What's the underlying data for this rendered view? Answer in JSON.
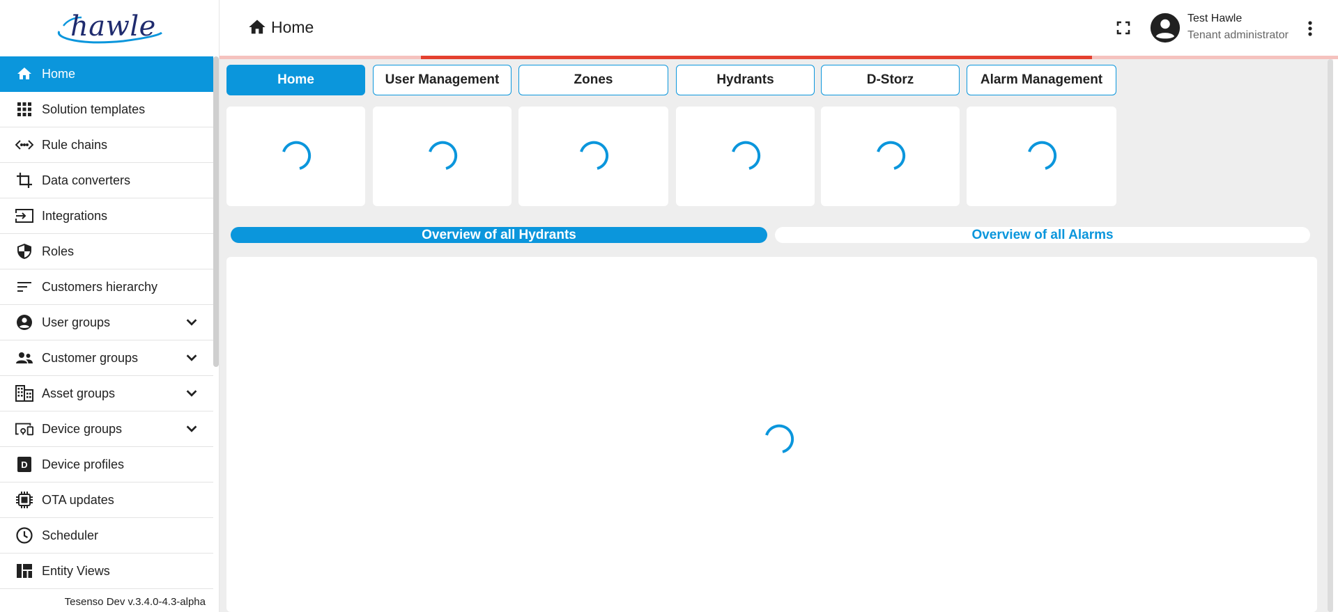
{
  "brand": {
    "logo_text": "hawle"
  },
  "sidebar": {
    "items": [
      {
        "label": "Home",
        "icon": "home-icon",
        "active": true,
        "expandable": false
      },
      {
        "label": "Solution templates",
        "icon": "apps-grid-icon",
        "active": false,
        "expandable": false
      },
      {
        "label": "Rule chains",
        "icon": "code-arrows-icon",
        "active": false,
        "expandable": false
      },
      {
        "label": "Data converters",
        "icon": "crop-icon",
        "active": false,
        "expandable": false
      },
      {
        "label": "Integrations",
        "icon": "input-icon",
        "active": false,
        "expandable": false
      },
      {
        "label": "Roles",
        "icon": "shield-icon",
        "active": false,
        "expandable": false
      },
      {
        "label": "Customers hierarchy",
        "icon": "sort-icon",
        "active": false,
        "expandable": false
      },
      {
        "label": "User groups",
        "icon": "account-circle-icon",
        "active": false,
        "expandable": true
      },
      {
        "label": "Customer groups",
        "icon": "supervisor-account-icon",
        "active": false,
        "expandable": true
      },
      {
        "label": "Asset groups",
        "icon": "domain-icon",
        "active": false,
        "expandable": true
      },
      {
        "label": "Device groups",
        "icon": "devices-other-icon",
        "active": false,
        "expandable": true
      },
      {
        "label": "Device profiles",
        "icon": "device-profile-icon",
        "active": false,
        "expandable": false
      },
      {
        "label": "OTA updates",
        "icon": "memory-chip-icon",
        "active": false,
        "expandable": false
      },
      {
        "label": "Scheduler",
        "icon": "clock-icon",
        "active": false,
        "expandable": false
      },
      {
        "label": "Entity Views",
        "icon": "view-quilt-icon",
        "active": false,
        "expandable": false
      }
    ],
    "version": "Tesenso Dev v.3.4.0-4.3-alpha"
  },
  "header": {
    "breadcrumb": "Home",
    "user_name": "Test Hawle",
    "user_role": "Tenant administrator",
    "loading_progress": 0.6
  },
  "dashboard": {
    "tabs": [
      {
        "label": "Home",
        "active": true
      },
      {
        "label": "User Management",
        "active": false
      },
      {
        "label": "Zones",
        "active": false
      },
      {
        "label": "Hydrants",
        "active": false
      },
      {
        "label": "D-Storz",
        "active": false
      },
      {
        "label": "Alarm Management",
        "active": false
      }
    ],
    "overview_tabs": [
      {
        "label": "Overview of all Hydrants",
        "active": true
      },
      {
        "label": "Overview of all Alarms",
        "active": false
      }
    ]
  },
  "colors": {
    "accent": "#0b96dc",
    "progress": "#e4412f",
    "progress_track": "#f5c2be",
    "background": "#eeeeee"
  }
}
